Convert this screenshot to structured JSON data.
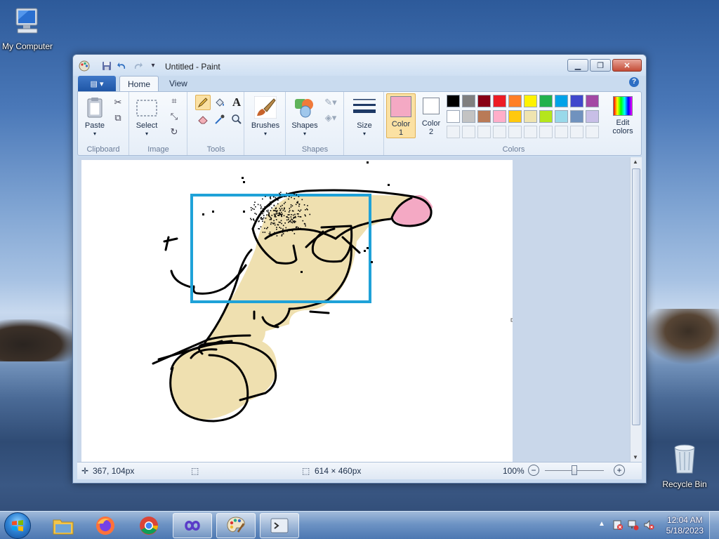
{
  "desktop": {
    "icons": [
      {
        "label": "My Computer"
      },
      {
        "label": "Recycle Bin"
      }
    ]
  },
  "window": {
    "title": "Untitled - Paint",
    "tabs": [
      {
        "label": "Home",
        "active": true
      },
      {
        "label": "View",
        "active": false
      }
    ],
    "help_label": "?"
  },
  "ribbon": {
    "clipboard": {
      "group_label": "Clipboard",
      "paste_label": "Paste"
    },
    "image": {
      "group_label": "Image",
      "select_label": "Select"
    },
    "tools": {
      "group_label": "Tools"
    },
    "brushes": {
      "label": "Brushes"
    },
    "shapes": {
      "group_label": "Shapes",
      "shapes_label": "Shapes"
    },
    "size": {
      "label": "Size"
    },
    "colors": {
      "group_label": "Colors",
      "color1_label": "Color",
      "color1_num": "1",
      "color1_value": "#f4a9c4",
      "color2_label": "Color",
      "color2_num": "2",
      "color2_value": "#ffffff",
      "edit_label_1": "Edit",
      "edit_label_2": "colors",
      "palette_row1": [
        "#000000",
        "#7f7f7f",
        "#880015",
        "#ed1c24",
        "#ff7f27",
        "#fff200",
        "#22b14c",
        "#00a2e8",
        "#3f48cc",
        "#a349a4"
      ],
      "palette_row2": [
        "#ffffff",
        "#c3c3c3",
        "#b97a57",
        "#ffaec9",
        "#ffc90e",
        "#efe4b0",
        "#b5e61d",
        "#99d9ea",
        "#7092be",
        "#c8bfe7"
      ]
    }
  },
  "drawing": {
    "fill_color": "#efe0b0",
    "tip_color": "#f4a9c4",
    "selection_color": "#1fa2d8"
  },
  "statusbar": {
    "cursor_pos": "367, 104px",
    "selection_size": "",
    "canvas_size": "614 × 460px",
    "zoom": "100%",
    "zoom_out": "−",
    "zoom_in": "+"
  },
  "taskbar": {
    "apps": [
      {
        "name": "file-explorer-app-icon"
      },
      {
        "name": "firefox-app-icon"
      },
      {
        "name": "chrome-app-icon"
      },
      {
        "name": "visual-studio-app-icon"
      },
      {
        "name": "paint-app-icon"
      },
      {
        "name": "terminal-app-icon"
      }
    ],
    "time": "12:04 AM",
    "date": "5/18/2023",
    "tray_expand": "▲"
  }
}
